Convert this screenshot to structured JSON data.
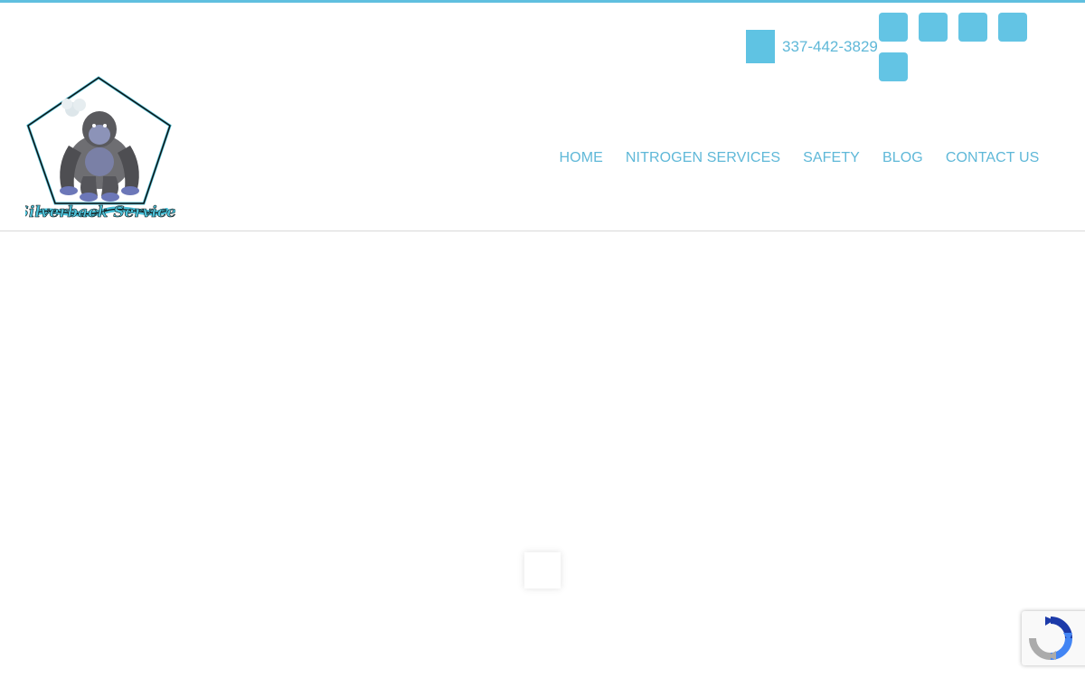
{
  "header": {
    "phone": {
      "number": "337-442-3829",
      "icon": "phone-icon"
    },
    "social_icons": [
      {
        "name": "facebook-icon"
      },
      {
        "name": "twitter-icon"
      },
      {
        "name": "linkedin-icon"
      },
      {
        "name": "instagram-icon"
      },
      {
        "name": "youtube-icon"
      }
    ],
    "logo": {
      "text": "Silverback Services"
    },
    "nav": {
      "items": [
        {
          "label": "HOME"
        },
        {
          "label": "NITROGEN SERVICES"
        },
        {
          "label": "SAFETY"
        },
        {
          "label": "BLOG"
        },
        {
          "label": "CONTACT US"
        }
      ]
    }
  },
  "colors": {
    "accent": "#5fbfdf",
    "link": "#5fb8d8",
    "icon_bg": "#63c4e4",
    "divider": "#d9d9d9"
  },
  "recaptcha": {
    "icon": "recaptcha-icon"
  }
}
